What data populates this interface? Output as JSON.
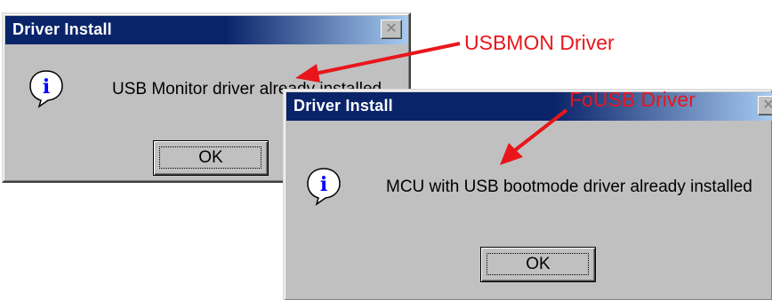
{
  "dialogs": [
    {
      "title": "Driver Install",
      "close_glyph": "✕",
      "icon": "info-icon",
      "icon_glyph": "i",
      "message": "USB Monitor driver already installed",
      "ok_label": "OK"
    },
    {
      "title": "Driver Install",
      "close_glyph": "✕",
      "icon": "info-icon",
      "icon_glyph": "i",
      "message": "MCU with USB bootmode driver already installed",
      "ok_label": "OK"
    }
  ],
  "annotations": [
    {
      "label": "USBMON Driver",
      "color": "#e8161b"
    },
    {
      "label": "FoUSB Driver",
      "color": "#e8161b"
    }
  ],
  "colors": {
    "titlebar": "#0a246a",
    "face": "#c0c0c0",
    "icon_blue": "#0000ff"
  }
}
